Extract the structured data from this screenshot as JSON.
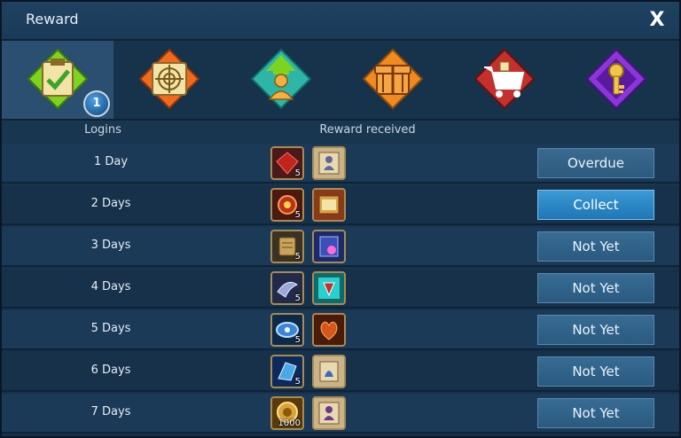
{
  "window": {
    "title": "Reward",
    "close_label": "X"
  },
  "tabs": [
    {
      "name": "daily-login",
      "icon": "check-clipboard-icon",
      "color": "#7ed321",
      "badge": "1",
      "active": true
    },
    {
      "name": "target",
      "icon": "target-scroll-icon",
      "color": "#f06a1e",
      "badge": null,
      "active": false
    },
    {
      "name": "growth",
      "icon": "person-up-arrow-icon",
      "color": "#2fb5a8",
      "badge": null,
      "active": false
    },
    {
      "name": "gift",
      "icon": "gift-box-icon",
      "color": "#f08a1e",
      "badge": null,
      "active": false
    },
    {
      "name": "shop",
      "icon": "shopping-cart-icon",
      "color": "#c4302b",
      "badge": null,
      "active": false
    },
    {
      "name": "key",
      "icon": "key-shield-icon",
      "color": "#8a36d8",
      "badge": null,
      "active": false
    }
  ],
  "table": {
    "headers": {
      "logins": "Logins",
      "reward": "Reward received"
    },
    "rows": [
      {
        "day": "1 Day",
        "items": [
          {
            "icon": "red-gem-icon",
            "qty": "5",
            "color": "#c0241c"
          },
          {
            "icon": "character-card-icon",
            "qty": "",
            "color": "#c9b48a"
          }
        ],
        "button": "Overdue",
        "state": "overdue"
      },
      {
        "day": "2 Days",
        "items": [
          {
            "icon": "fire-orb-icon",
            "qty": "5",
            "color": "#b8321c"
          },
          {
            "icon": "treasure-scroll-icon",
            "qty": "",
            "color": "#c28a3a"
          }
        ],
        "button": "Collect",
        "state": "collect"
      },
      {
        "day": "3 Days",
        "items": [
          {
            "icon": "gold-scroll-icon",
            "qty": "5",
            "color": "#a88a52"
          },
          {
            "icon": "magic-card-icon",
            "qty": "",
            "color": "#5a6fd8"
          }
        ],
        "button": "Not Yet",
        "state": "notyet"
      },
      {
        "day": "4 Days",
        "items": [
          {
            "icon": "silver-wing-icon",
            "qty": "5",
            "color": "#6c7fb5"
          },
          {
            "icon": "teal-crystal-icon",
            "qty": "",
            "color": "#2ad0d0"
          }
        ],
        "button": "Not Yet",
        "state": "notyet"
      },
      {
        "day": "5 Days",
        "items": [
          {
            "icon": "blue-orb-icon",
            "qty": "5",
            "color": "#3c86d6"
          },
          {
            "icon": "flame-heart-icon",
            "qty": "",
            "color": "#d8561c"
          }
        ],
        "button": "Not Yet",
        "state": "notyet"
      },
      {
        "day": "6 Days",
        "items": [
          {
            "icon": "ice-crystal-icon",
            "qty": "5",
            "color": "#4aa8e8"
          },
          {
            "icon": "blue-scroll-icon",
            "qty": "",
            "color": "#c9b48a"
          }
        ],
        "button": "Not Yet",
        "state": "notyet"
      },
      {
        "day": "7 Days",
        "items": [
          {
            "icon": "gold-coin-icon",
            "qty": "1000",
            "color": "#d9a53a"
          },
          {
            "icon": "hero-card-icon",
            "qty": "",
            "color": "#c9b48a"
          }
        ],
        "button": "Not Yet",
        "state": "notyet"
      }
    ]
  }
}
